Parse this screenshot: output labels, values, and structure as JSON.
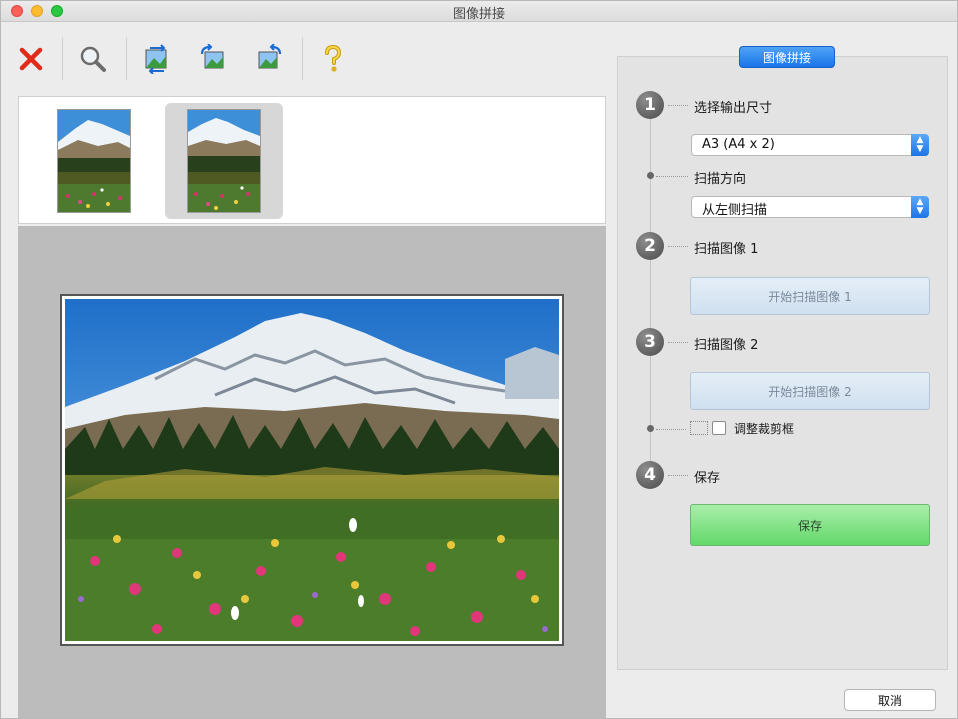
{
  "window": {
    "title": "图像拼接"
  },
  "toolbar": {
    "icons": [
      "close-x-icon",
      "magnifier-icon",
      "swap-images-icon",
      "rotate-left-icon",
      "rotate-right-icon",
      "help-icon"
    ]
  },
  "thumbnails": {
    "count": 2,
    "selected_index": 1
  },
  "panel": {
    "tab_label": "图像拼接",
    "steps": [
      {
        "number": "1",
        "label": "选择输出尺寸"
      },
      {
        "number": "2",
        "label": "扫描图像 1"
      },
      {
        "number": "3",
        "label": "扫描图像 2"
      },
      {
        "number": "4",
        "label": "保存"
      }
    ],
    "output_size": {
      "value": "A3 (A4 x 2)"
    },
    "scan_direction": {
      "label": "扫描方向",
      "value": "从左侧扫描"
    },
    "scan1_button": "开始扫描图像 1",
    "scan2_button": "开始扫描图像 2",
    "adjust_crop": {
      "label": "调整裁剪框",
      "checked": false
    },
    "save_button": "保存"
  },
  "footer": {
    "cancel_button": "取消"
  },
  "colors": {
    "tab": "#1a74e8",
    "save": "#63d86a",
    "close_icon": "#e02a1a"
  }
}
